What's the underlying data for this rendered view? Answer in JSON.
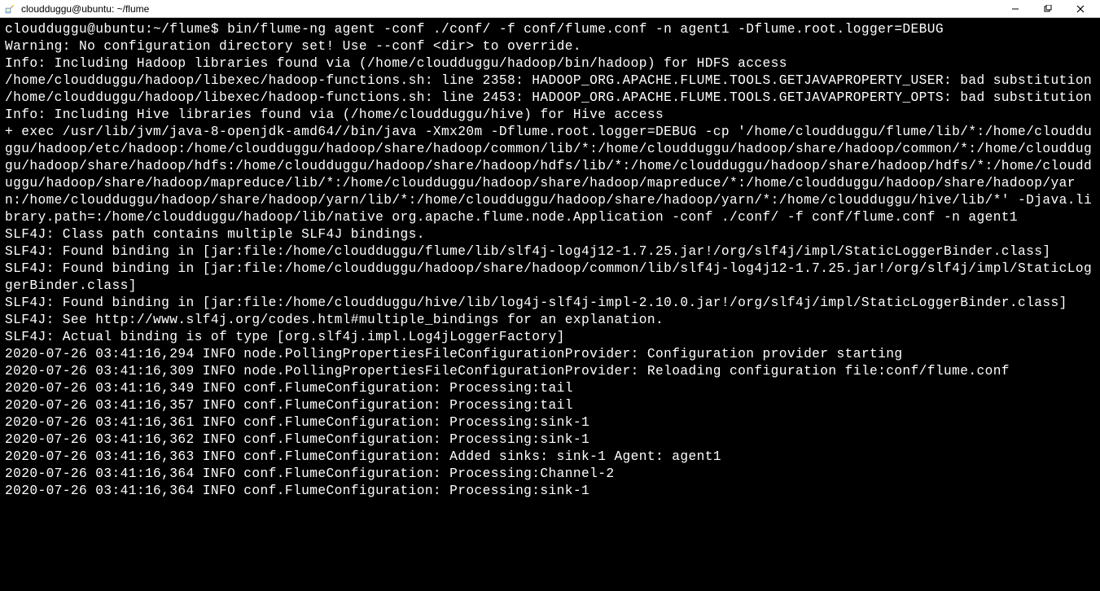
{
  "window": {
    "title": "cloudduggu@ubuntu: ~/flume"
  },
  "terminal": {
    "lines": [
      "cloudduggu@ubuntu:~/flume$ bin/flume-ng agent -conf ./conf/ -f conf/flume.conf -n agent1 -Dflume.root.logger=DEBUG",
      "Warning: No configuration directory set! Use --conf <dir> to override.",
      "Info: Including Hadoop libraries found via (/home/cloudduggu/hadoop/bin/hadoop) for HDFS access",
      "/home/cloudduggu/hadoop/libexec/hadoop-functions.sh: line 2358: HADOOP_ORG.APACHE.FLUME.TOOLS.GETJAVAPROPERTY_USER: bad substitution",
      "/home/cloudduggu/hadoop/libexec/hadoop-functions.sh: line 2453: HADOOP_ORG.APACHE.FLUME.TOOLS.GETJAVAPROPERTY_OPTS: bad substitution",
      "Info: Including Hive libraries found via (/home/cloudduggu/hive) for Hive access",
      "+ exec /usr/lib/jvm/java-8-openjdk-amd64//bin/java -Xmx20m -Dflume.root.logger=DEBUG -cp '/home/cloudduggu/flume/lib/*:/home/cloudduggu/hadoop/etc/hadoop:/home/cloudduggu/hadoop/share/hadoop/common/lib/*:/home/cloudduggu/hadoop/share/hadoop/common/*:/home/cloudduggu/hadoop/share/hadoop/hdfs:/home/cloudduggu/hadoop/share/hadoop/hdfs/lib/*:/home/cloudduggu/hadoop/share/hadoop/hdfs/*:/home/cloudduggu/hadoop/share/hadoop/mapreduce/lib/*:/home/cloudduggu/hadoop/share/hadoop/mapreduce/*:/home/cloudduggu/hadoop/share/hadoop/yarn:/home/cloudduggu/hadoop/share/hadoop/yarn/lib/*:/home/cloudduggu/hadoop/share/hadoop/yarn/*:/home/cloudduggu/hive/lib/*' -Djava.library.path=:/home/cloudduggu/hadoop/lib/native org.apache.flume.node.Application -conf ./conf/ -f conf/flume.conf -n agent1",
      "SLF4J: Class path contains multiple SLF4J bindings.",
      "SLF4J: Found binding in [jar:file:/home/cloudduggu/flume/lib/slf4j-log4j12-1.7.25.jar!/org/slf4j/impl/StaticLoggerBinder.class]",
      "SLF4J: Found binding in [jar:file:/home/cloudduggu/hadoop/share/hadoop/common/lib/slf4j-log4j12-1.7.25.jar!/org/slf4j/impl/StaticLoggerBinder.class]",
      "SLF4J: Found binding in [jar:file:/home/cloudduggu/hive/lib/log4j-slf4j-impl-2.10.0.jar!/org/slf4j/impl/StaticLoggerBinder.class]",
      "SLF4J: See http://www.slf4j.org/codes.html#multiple_bindings for an explanation.",
      "SLF4J: Actual binding is of type [org.slf4j.impl.Log4jLoggerFactory]",
      "2020-07-26 03:41:16,294 INFO node.PollingPropertiesFileConfigurationProvider: Configuration provider starting",
      "2020-07-26 03:41:16,309 INFO node.PollingPropertiesFileConfigurationProvider: Reloading configuration file:conf/flume.conf",
      "2020-07-26 03:41:16,349 INFO conf.FlumeConfiguration: Processing:tail",
      "2020-07-26 03:41:16,357 INFO conf.FlumeConfiguration: Processing:tail",
      "2020-07-26 03:41:16,361 INFO conf.FlumeConfiguration: Processing:sink-1",
      "2020-07-26 03:41:16,362 INFO conf.FlumeConfiguration: Processing:sink-1",
      "2020-07-26 03:41:16,363 INFO conf.FlumeConfiguration: Added sinks: sink-1 Agent: agent1",
      "2020-07-26 03:41:16,364 INFO conf.FlumeConfiguration: Processing:Channel-2",
      "2020-07-26 03:41:16,364 INFO conf.FlumeConfiguration: Processing:sink-1"
    ]
  }
}
